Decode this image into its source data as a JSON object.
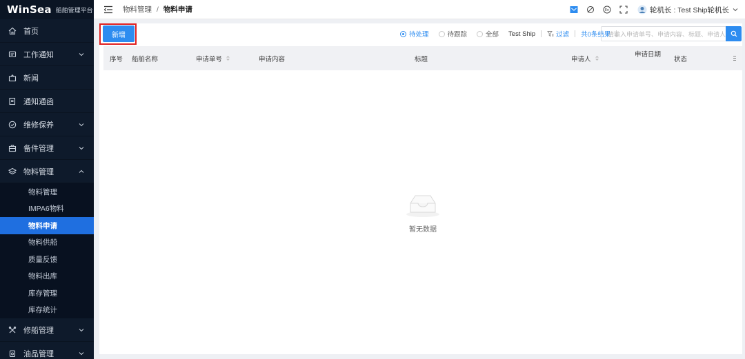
{
  "app": {
    "brand": "WinSea",
    "subtitle": "船舶管理平台"
  },
  "sidebar": {
    "items": [
      {
        "label": "首页",
        "icon": "home-icon"
      },
      {
        "label": "工作通知",
        "icon": "message-icon",
        "expandable": true
      },
      {
        "label": "新闻",
        "icon": "news-icon"
      },
      {
        "label": "通知通函",
        "icon": "notice-icon"
      },
      {
        "label": "维修保养",
        "icon": "check-circle-icon",
        "expandable": true
      },
      {
        "label": "备件管理",
        "icon": "briefcase-icon",
        "expandable": true
      },
      {
        "label": "物料管理",
        "icon": "layers-icon",
        "expandable": true,
        "expanded": true
      },
      {
        "label": "修船管理",
        "icon": "tools-icon",
        "expandable": true
      },
      {
        "label": "油品管理",
        "icon": "oil-icon",
        "expandable": true
      }
    ],
    "submenu": [
      {
        "label": "物料管理"
      },
      {
        "label": "IMPA6物料"
      },
      {
        "label": "物料申请",
        "active": true
      },
      {
        "label": "物料供船"
      },
      {
        "label": "质量反馈"
      },
      {
        "label": "物料出库"
      },
      {
        "label": "库存管理"
      },
      {
        "label": "库存统计"
      }
    ]
  },
  "header": {
    "breadcrumb": [
      "物料管理",
      "物料申请"
    ],
    "user": "轮机长 : Test Ship轮机长"
  },
  "toolbar": {
    "add_label": "新增",
    "radios": [
      {
        "label": "待处理",
        "checked": true
      },
      {
        "label": "待跟踪",
        "checked": false
      },
      {
        "label": "全部",
        "checked": false
      }
    ],
    "ship": "Test Ship",
    "filter_label": "过滤",
    "total": "共0条结果",
    "search_placeholder": "请输入申请单号、申请内容、标题、申请人"
  },
  "table": {
    "columns": [
      "序号",
      "船舶名称",
      "申请单号",
      "申请内容",
      "标题",
      "申请人",
      "申请日期",
      "状态"
    ]
  },
  "empty": {
    "text": "暂无数据"
  },
  "colors": {
    "sidebar_bg": "#0e1a2b",
    "accent": "#2d8cf0",
    "active_sub": "#1f6fe0",
    "highlight": "#e02020"
  }
}
